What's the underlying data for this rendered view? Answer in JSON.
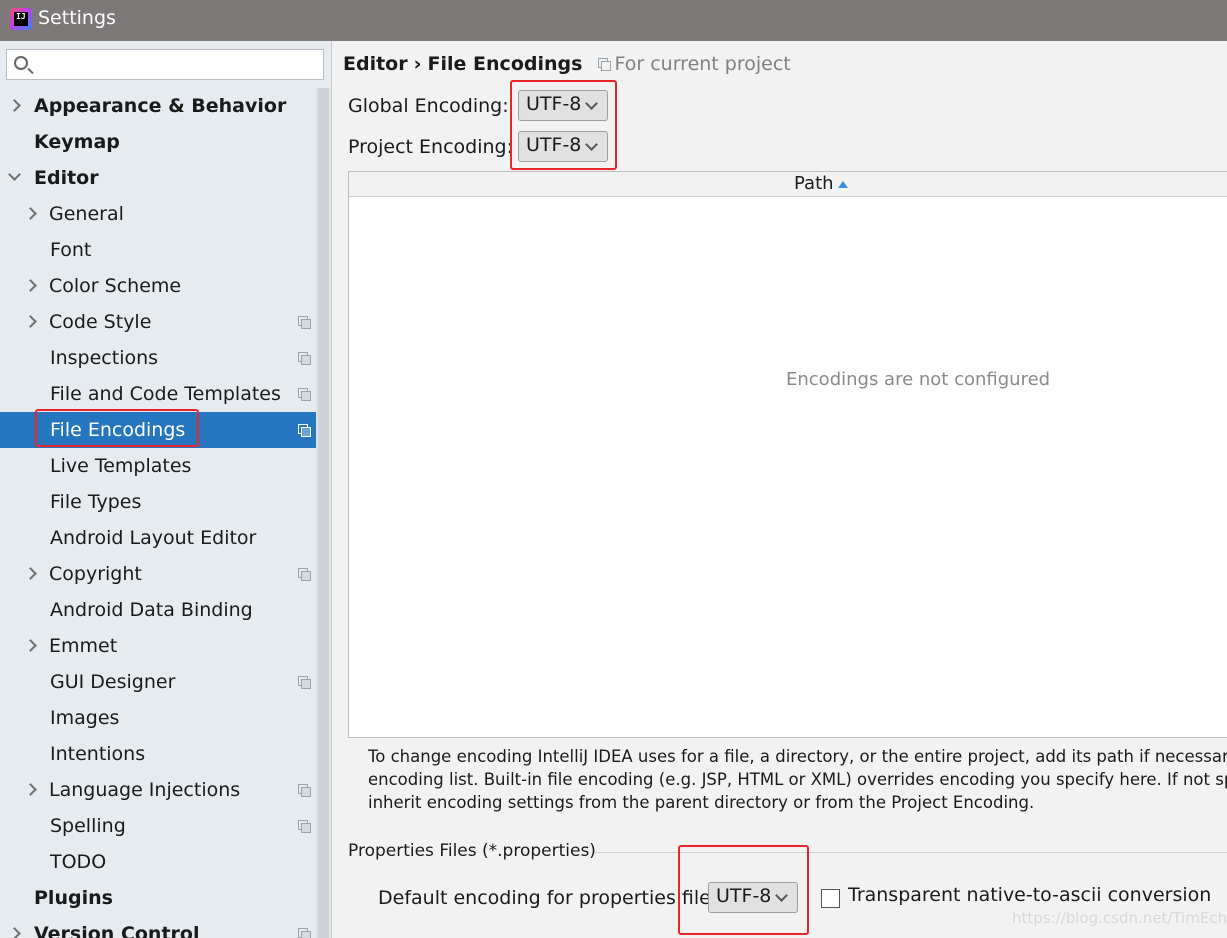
{
  "window": {
    "title": "Settings"
  },
  "search": {
    "placeholder": "",
    "value": ""
  },
  "sidebar": {
    "items": [
      {
        "label": "Appearance & Behavior",
        "level": 0,
        "arrow": "right",
        "scoped": false
      },
      {
        "label": "Keymap",
        "level": 0,
        "arrow": "none",
        "scoped": false
      },
      {
        "label": "Editor",
        "level": 0,
        "arrow": "down",
        "scoped": false
      },
      {
        "label": "General",
        "level": 1,
        "arrow": "right",
        "scoped": false
      },
      {
        "label": "Font",
        "level": 1,
        "arrow": "none",
        "scoped": false
      },
      {
        "label": "Color Scheme",
        "level": 1,
        "arrow": "right",
        "scoped": false
      },
      {
        "label": "Code Style",
        "level": 1,
        "arrow": "right",
        "scoped": true
      },
      {
        "label": "Inspections",
        "level": 1,
        "arrow": "none",
        "scoped": true
      },
      {
        "label": "File and Code Templates",
        "level": 1,
        "arrow": "none",
        "scoped": true
      },
      {
        "label": "File Encodings",
        "level": 1,
        "arrow": "none",
        "scoped": true,
        "selected": true
      },
      {
        "label": "Live Templates",
        "level": 1,
        "arrow": "none",
        "scoped": false
      },
      {
        "label": "File Types",
        "level": 1,
        "arrow": "none",
        "scoped": false
      },
      {
        "label": "Android Layout Editor",
        "level": 1,
        "arrow": "none",
        "scoped": false
      },
      {
        "label": "Copyright",
        "level": 1,
        "arrow": "right",
        "scoped": true
      },
      {
        "label": "Android Data Binding",
        "level": 1,
        "arrow": "none",
        "scoped": false
      },
      {
        "label": "Emmet",
        "level": 1,
        "arrow": "right",
        "scoped": false
      },
      {
        "label": "GUI Designer",
        "level": 1,
        "arrow": "none",
        "scoped": true
      },
      {
        "label": "Images",
        "level": 1,
        "arrow": "none",
        "scoped": false
      },
      {
        "label": "Intentions",
        "level": 1,
        "arrow": "none",
        "scoped": false
      },
      {
        "label": "Language Injections",
        "level": 1,
        "arrow": "right",
        "scoped": true
      },
      {
        "label": "Spelling",
        "level": 1,
        "arrow": "none",
        "scoped": true
      },
      {
        "label": "TODO",
        "level": 1,
        "arrow": "none",
        "scoped": false
      },
      {
        "label": "Plugins",
        "level": 0,
        "arrow": "none",
        "scoped": false
      },
      {
        "label": "Version Control",
        "level": 0,
        "arrow": "right",
        "scoped": true
      }
    ]
  },
  "breadcrumb": {
    "parent": "Editor",
    "separator": "›",
    "current": "File Encodings",
    "scope": "For current project"
  },
  "encodings": {
    "global_label": "Global Encoding:",
    "global_value": "UTF-8",
    "project_label": "Project Encoding:",
    "project_value": "UTF-8"
  },
  "table": {
    "column_path": "Path",
    "empty_text": "Encodings are not configured"
  },
  "help": {
    "lines": [
      "To change encoding IntelliJ IDEA uses for a file, a directory, or the entire project, add its path if necessary",
      "encoding list. Built-in file encoding (e.g. JSP, HTML or XML) overrides encoding you specify here. If not sp",
      "inherit encoding settings from the parent directory or from the Project Encoding."
    ]
  },
  "properties": {
    "section_title": "Properties Files (*.properties)",
    "default_label": "Default encoding for properties files:",
    "default_value": "UTF-8",
    "transparent_label": "Transparent native-to-ascii conversion",
    "transparent_checked": false
  },
  "watermark": "https://blog.csdn.net/TimEcho",
  "colors": {
    "selection": "#2675bf",
    "highlight": "#e8262b",
    "titlebar": "#7d7878"
  }
}
